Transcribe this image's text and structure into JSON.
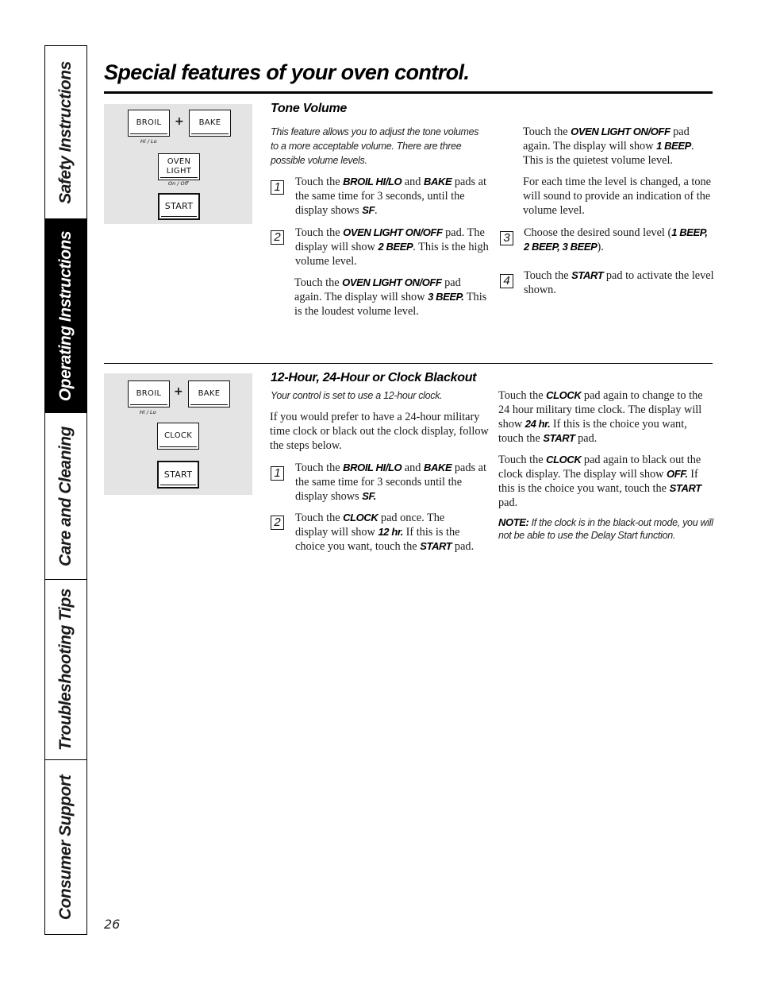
{
  "sidebar": {
    "tabs": [
      {
        "label": "Safety Instructions",
        "active": false
      },
      {
        "label": "Operating Instructions",
        "active": true
      },
      {
        "label": "Care and Cleaning",
        "active": false
      },
      {
        "label": "Troubleshooting Tips",
        "active": false
      },
      {
        "label": "Consumer Support",
        "active": false
      }
    ]
  },
  "page": {
    "title": "Special features of your oven control.",
    "number": "26"
  },
  "tone_volume": {
    "keypad": {
      "broil": "BROIL",
      "broil_sub": "Hi / Lo",
      "plus": "+",
      "bake": "BAKE",
      "oven_light_1": "OVEN",
      "oven_light_2": "LIGHT",
      "oven_light_sub": "On / Off",
      "start": "START"
    },
    "heading": "Tone Volume",
    "intro": "This feature allows you to adjust the tone volumes to a more acceptable volume. There are three possible volume levels.",
    "steps": [
      {
        "num": "1",
        "parts": [
          "Touch the ",
          "BROIL HI/LO",
          " and ",
          "BAKE",
          " pads at the same time for 3 seconds, until the display shows ",
          "SF",
          "."
        ]
      },
      {
        "num": "2",
        "parts": [
          "Touch the ",
          "OVEN LIGHT ON/OFF",
          " pad. The display will show ",
          "2 BEEP",
          ". This is the high volume level."
        ]
      },
      {
        "num": "",
        "parts": [
          "Touch the ",
          "OVEN LIGHT ON/OFF",
          " pad again. The display will show ",
          "3 BEEP.",
          " This is the loudest volume level."
        ]
      },
      {
        "num": "",
        "parts": [
          "Touch the ",
          "OVEN LIGHT ON/OFF",
          " pad again. The display will show ",
          "1 BEEP",
          ". This is the quietest volume level."
        ]
      },
      {
        "num": "",
        "parts": [
          "For each time the level is changed, a tone will sound to provide an indication of the volume level."
        ]
      },
      {
        "num": "3",
        "parts": [
          "Choose the desired sound level (",
          "1 BEEP, 2 BEEP, 3 BEEP",
          ")."
        ]
      },
      {
        "num": "4",
        "parts": [
          "Touch the ",
          "START",
          " pad to activate the level shown."
        ]
      }
    ]
  },
  "clock": {
    "keypad": {
      "broil": "BROIL",
      "broil_sub": "Hi / Lo",
      "plus": "+",
      "bake": "BAKE",
      "clock": "CLOCK",
      "start": "START"
    },
    "heading": "12-Hour, 24-Hour or Clock Blackout",
    "subtitle": "Your control is set to use a 12-hour clock.",
    "intro": "If you would prefer to have a 24-hour military time clock or black out the clock display, follow the steps below.",
    "steps": [
      {
        "num": "1",
        "parts": [
          "Touch the ",
          "BROIL HI/LO",
          " and ",
          "BAKE",
          " pads at the same time for 3 seconds until the display shows ",
          "SF."
        ]
      },
      {
        "num": "2",
        "parts": [
          "Touch the ",
          "CLOCK",
          " pad once. The display will show ",
          "12 hr.",
          " If this is the choice you want, touch the ",
          "START",
          " pad."
        ]
      },
      {
        "num": "",
        "parts": [
          "Touch the ",
          "CLOCK",
          " pad again to change to the 24 hour military time clock. The display will show ",
          "24 hr.",
          " If this is the choice you want, touch the ",
          "START",
          " pad."
        ]
      },
      {
        "num": "",
        "parts": [
          "Touch the ",
          "CLOCK",
          " pad again to black out the clock display. The display will show ",
          "OFF.",
          " If this is the choice you want, touch the ",
          "START",
          " pad."
        ]
      }
    ],
    "note_label": "NOTE:",
    "note_text": " If the clock is in the black-out mode, you will not be able to use the Delay Start function."
  }
}
